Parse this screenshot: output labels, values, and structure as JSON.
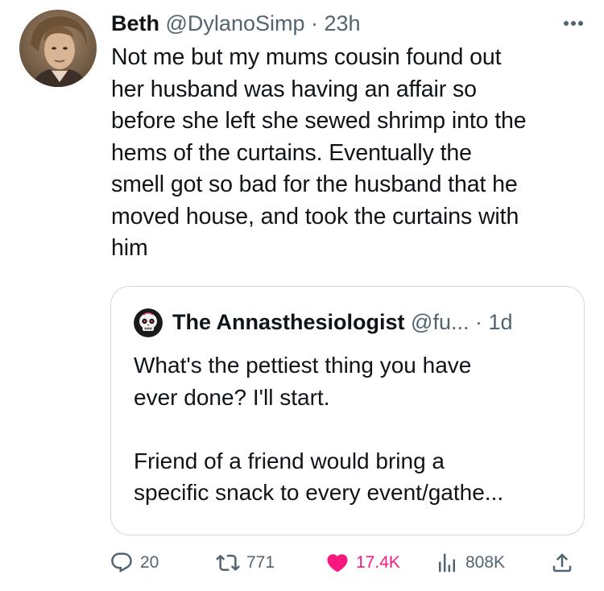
{
  "tweet": {
    "author_name": "Beth",
    "handle": "@DylanoSimp",
    "separator": "·",
    "time": "23h",
    "lines": [
      "Not me but my mums cousin found out",
      "her husband was having an affair so",
      "before she left she sewed shrimp into the",
      "hems of the curtains. Eventually the",
      "smell got so bad for the husband that he",
      "moved house, and took the curtains with",
      "him"
    ]
  },
  "quote": {
    "author_name": "The Annasthesiologist",
    "handle": "@fu...",
    "separator": "·",
    "time": "1d",
    "text": "What's the pettiest thing you have\never done?  I'll start.\n\nFriend of a friend would bring a\nspecific snack to every event/gathe..."
  },
  "actions": {
    "replies": "20",
    "reposts": "771",
    "likes": "17.4K",
    "views": "808K"
  },
  "colors": {
    "text": "#0f1419",
    "secondary": "#536471",
    "like": "#f91880",
    "border": "#cfd9de"
  },
  "icons": [
    "more-icon",
    "reply-icon",
    "repost-icon",
    "heart-icon",
    "views-icon",
    "share-icon"
  ]
}
